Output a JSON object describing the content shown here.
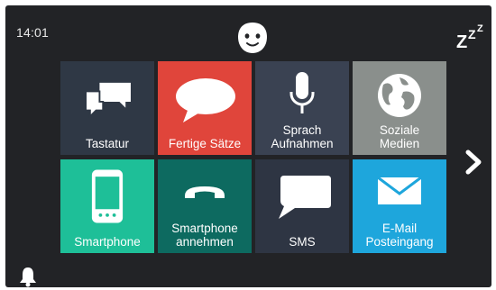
{
  "status": {
    "time": "14:01"
  },
  "icons": {
    "face": "face-icon",
    "sleep": "sleep-icon",
    "next": "chevron-right-icon",
    "bell": "bell-icon"
  },
  "tiles": [
    {
      "label": "Tastatur",
      "icon": "chat-bubbles-icon",
      "color": "#2f3845"
    },
    {
      "label": "Fertige Sätze",
      "icon": "speech-bubble-icon",
      "color": "#e0453b"
    },
    {
      "label": "Sprach\nAufnahmen",
      "icon": "microphone-icon",
      "color": "#3a4252"
    },
    {
      "label": "Soziale\nMedien",
      "icon": "globe-icon",
      "color": "#8a8f8c"
    },
    {
      "label": "Smartphone",
      "icon": "smartphone-icon",
      "color": "#1ebf98"
    },
    {
      "label": "Smartphone\nannehmen",
      "icon": "phone-handset-icon",
      "color": "#0d6a60"
    },
    {
      "label": "SMS",
      "icon": "sms-bubble-icon",
      "color": "#2e3543"
    },
    {
      "label": "E-Mail\nPosteingang",
      "icon": "envelope-icon",
      "color": "#1ea6dc"
    }
  ]
}
